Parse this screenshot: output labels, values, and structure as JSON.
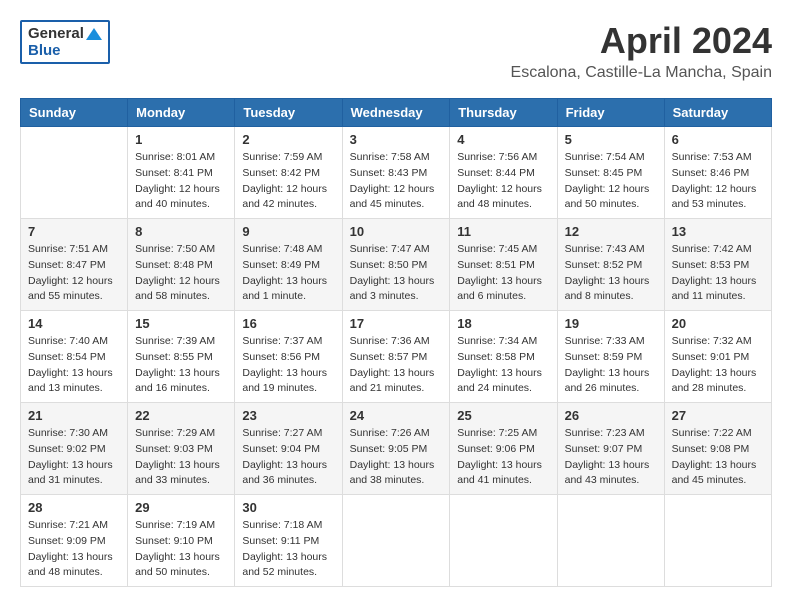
{
  "header": {
    "logo_general": "General",
    "logo_blue": "Blue",
    "month_title": "April 2024",
    "location": "Escalona, Castille-La Mancha, Spain"
  },
  "columns": [
    "Sunday",
    "Monday",
    "Tuesday",
    "Wednesday",
    "Thursday",
    "Friday",
    "Saturday"
  ],
  "weeks": [
    [
      {
        "day": "",
        "info": ""
      },
      {
        "day": "1",
        "info": "Sunrise: 8:01 AM\nSunset: 8:41 PM\nDaylight: 12 hours\nand 40 minutes."
      },
      {
        "day": "2",
        "info": "Sunrise: 7:59 AM\nSunset: 8:42 PM\nDaylight: 12 hours\nand 42 minutes."
      },
      {
        "day": "3",
        "info": "Sunrise: 7:58 AM\nSunset: 8:43 PM\nDaylight: 12 hours\nand 45 minutes."
      },
      {
        "day": "4",
        "info": "Sunrise: 7:56 AM\nSunset: 8:44 PM\nDaylight: 12 hours\nand 48 minutes."
      },
      {
        "day": "5",
        "info": "Sunrise: 7:54 AM\nSunset: 8:45 PM\nDaylight: 12 hours\nand 50 minutes."
      },
      {
        "day": "6",
        "info": "Sunrise: 7:53 AM\nSunset: 8:46 PM\nDaylight: 12 hours\nand 53 minutes."
      }
    ],
    [
      {
        "day": "7",
        "info": "Sunrise: 7:51 AM\nSunset: 8:47 PM\nDaylight: 12 hours\nand 55 minutes."
      },
      {
        "day": "8",
        "info": "Sunrise: 7:50 AM\nSunset: 8:48 PM\nDaylight: 12 hours\nand 58 minutes."
      },
      {
        "day": "9",
        "info": "Sunrise: 7:48 AM\nSunset: 8:49 PM\nDaylight: 13 hours\nand 1 minute."
      },
      {
        "day": "10",
        "info": "Sunrise: 7:47 AM\nSunset: 8:50 PM\nDaylight: 13 hours\nand 3 minutes."
      },
      {
        "day": "11",
        "info": "Sunrise: 7:45 AM\nSunset: 8:51 PM\nDaylight: 13 hours\nand 6 minutes."
      },
      {
        "day": "12",
        "info": "Sunrise: 7:43 AM\nSunset: 8:52 PM\nDaylight: 13 hours\nand 8 minutes."
      },
      {
        "day": "13",
        "info": "Sunrise: 7:42 AM\nSunset: 8:53 PM\nDaylight: 13 hours\nand 11 minutes."
      }
    ],
    [
      {
        "day": "14",
        "info": "Sunrise: 7:40 AM\nSunset: 8:54 PM\nDaylight: 13 hours\nand 13 minutes."
      },
      {
        "day": "15",
        "info": "Sunrise: 7:39 AM\nSunset: 8:55 PM\nDaylight: 13 hours\nand 16 minutes."
      },
      {
        "day": "16",
        "info": "Sunrise: 7:37 AM\nSunset: 8:56 PM\nDaylight: 13 hours\nand 19 minutes."
      },
      {
        "day": "17",
        "info": "Sunrise: 7:36 AM\nSunset: 8:57 PM\nDaylight: 13 hours\nand 21 minutes."
      },
      {
        "day": "18",
        "info": "Sunrise: 7:34 AM\nSunset: 8:58 PM\nDaylight: 13 hours\nand 24 minutes."
      },
      {
        "day": "19",
        "info": "Sunrise: 7:33 AM\nSunset: 8:59 PM\nDaylight: 13 hours\nand 26 minutes."
      },
      {
        "day": "20",
        "info": "Sunrise: 7:32 AM\nSunset: 9:01 PM\nDaylight: 13 hours\nand 28 minutes."
      }
    ],
    [
      {
        "day": "21",
        "info": "Sunrise: 7:30 AM\nSunset: 9:02 PM\nDaylight: 13 hours\nand 31 minutes."
      },
      {
        "day": "22",
        "info": "Sunrise: 7:29 AM\nSunset: 9:03 PM\nDaylight: 13 hours\nand 33 minutes."
      },
      {
        "day": "23",
        "info": "Sunrise: 7:27 AM\nSunset: 9:04 PM\nDaylight: 13 hours\nand 36 minutes."
      },
      {
        "day": "24",
        "info": "Sunrise: 7:26 AM\nSunset: 9:05 PM\nDaylight: 13 hours\nand 38 minutes."
      },
      {
        "day": "25",
        "info": "Sunrise: 7:25 AM\nSunset: 9:06 PM\nDaylight: 13 hours\nand 41 minutes."
      },
      {
        "day": "26",
        "info": "Sunrise: 7:23 AM\nSunset: 9:07 PM\nDaylight: 13 hours\nand 43 minutes."
      },
      {
        "day": "27",
        "info": "Sunrise: 7:22 AM\nSunset: 9:08 PM\nDaylight: 13 hours\nand 45 minutes."
      }
    ],
    [
      {
        "day": "28",
        "info": "Sunrise: 7:21 AM\nSunset: 9:09 PM\nDaylight: 13 hours\nand 48 minutes."
      },
      {
        "day": "29",
        "info": "Sunrise: 7:19 AM\nSunset: 9:10 PM\nDaylight: 13 hours\nand 50 minutes."
      },
      {
        "day": "30",
        "info": "Sunrise: 7:18 AM\nSunset: 9:11 PM\nDaylight: 13 hours\nand 52 minutes."
      },
      {
        "day": "",
        "info": ""
      },
      {
        "day": "",
        "info": ""
      },
      {
        "day": "",
        "info": ""
      },
      {
        "day": "",
        "info": ""
      }
    ]
  ]
}
